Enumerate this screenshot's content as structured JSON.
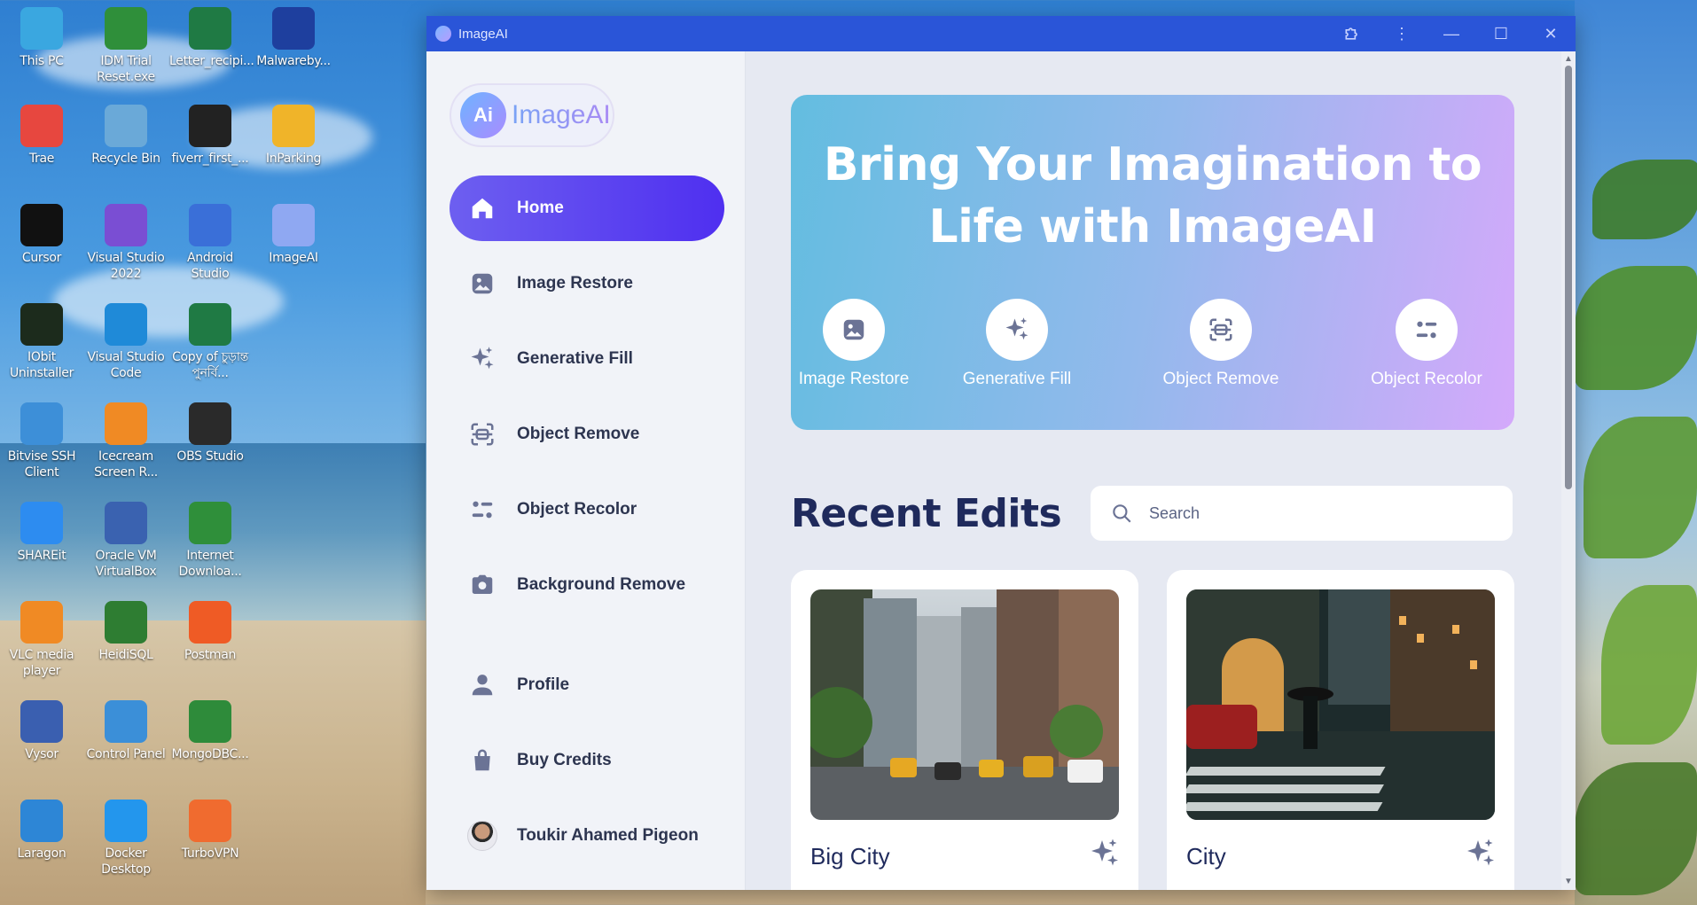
{
  "desktop": {
    "icons": [
      {
        "label": "This PC",
        "color": "#3aa7e0"
      },
      {
        "label": "IDM Trial Reset.exe",
        "color": "#2f8f3a"
      },
      {
        "label": "Letter_recipi...",
        "color": "#1f7a44"
      },
      {
        "label": "Malwareby...",
        "color": "#1e3f9e"
      },
      {
        "label": "Trae",
        "color": "#e7473f"
      },
      {
        "label": "Recycle Bin",
        "color": "#6aa9d8"
      },
      {
        "label": "fiverr_first_...",
        "color": "#222222"
      },
      {
        "label": "InParking",
        "color": "#f0b429"
      },
      {
        "label": "Cursor",
        "color": "#111111"
      },
      {
        "label": "Visual Studio 2022",
        "color": "#7a4ed3"
      },
      {
        "label": "Android Studio",
        "color": "#3a6fd8"
      },
      {
        "label": "ImageAI",
        "color": "#8fa8f2"
      },
      {
        "label": "IObit Uninstaller",
        "color": "#1c2b1c"
      },
      {
        "label": "Visual Studio Code",
        "color": "#1f8ad8"
      },
      {
        "label": "Copy of চুড়ান্ত পুনর্বি...",
        "color": "#1f7a44"
      },
      {
        "label": "Bitvise SSH Client",
        "color": "#3d8fd8"
      },
      {
        "label": "Icecream Screen R...",
        "color": "#f08a24"
      },
      {
        "label": "OBS Studio",
        "color": "#2a2a2a"
      },
      {
        "label": "SHAREit",
        "color": "#2d8cf0"
      },
      {
        "label": "Oracle VM VirtualBox",
        "color": "#3a62b0"
      },
      {
        "label": "Internet Downloa...",
        "color": "#2f8f3a"
      },
      {
        "label": "VLC media player",
        "color": "#f08a24"
      },
      {
        "label": "HeidiSQL",
        "color": "#2e7d32"
      },
      {
        "label": "Postman",
        "color": "#ef5b25"
      },
      {
        "label": "Vysor",
        "color": "#3a5fb0"
      },
      {
        "label": "Control Panel",
        "color": "#3b8fd8"
      },
      {
        "label": "MongoDBC...",
        "color": "#2e8b3a"
      },
      {
        "label": "Laragon",
        "color": "#2d86d6"
      },
      {
        "label": "Docker Desktop",
        "color": "#2396ed"
      },
      {
        "label": "TurboVPN",
        "color": "#f06b2f"
      }
    ]
  },
  "window": {
    "title": "ImageAI",
    "controls": {
      "extension_icon": "puzzle-icon",
      "more_icon": "more-vertical-icon",
      "minimize": "—",
      "maximize": "☐",
      "close": "✕"
    }
  },
  "sidebar": {
    "logo_mark": "Ai",
    "logo_text": "ImageAI",
    "nav": [
      {
        "label": "Home",
        "icon": "home-icon",
        "active": true
      },
      {
        "label": "Image Restore",
        "icon": "image-icon"
      },
      {
        "label": "Generative Fill",
        "icon": "sparkles-icon"
      },
      {
        "label": "Object Remove",
        "icon": "object-remove-icon"
      },
      {
        "label": "Object Recolor",
        "icon": "recolor-icon"
      },
      {
        "label": "Background Remove",
        "icon": "camera-icon"
      }
    ],
    "account": [
      {
        "label": "Profile",
        "icon": "user-icon"
      },
      {
        "label": "Buy Credits",
        "icon": "shopping-bag-icon"
      }
    ],
    "user_name": "Toukir Ahamed Pigeon"
  },
  "hero": {
    "title": "Bring Your Imagination to Life with ImageAI",
    "features": [
      {
        "label": "Image Restore",
        "icon": "image-icon"
      },
      {
        "label": "Generative Fill",
        "icon": "sparkles-icon"
      },
      {
        "label": "Object Remove",
        "icon": "object-remove-icon"
      },
      {
        "label": "Object Recolor",
        "icon": "recolor-icon"
      }
    ]
  },
  "recent": {
    "title": "Recent Edits",
    "search_placeholder": "Search",
    "cards": [
      {
        "title": "Big City"
      },
      {
        "title": "City"
      }
    ]
  },
  "colors": {
    "accent": "#5a3cf0",
    "titlebar": "#2a55d8",
    "heading": "#1f2a5c"
  }
}
